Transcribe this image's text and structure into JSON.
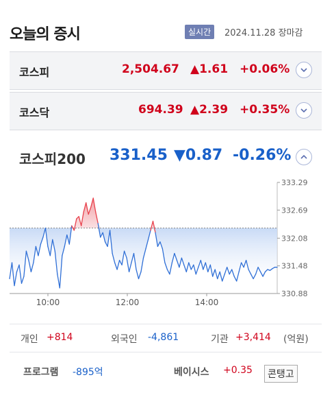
{
  "header": {
    "title": "오늘의 증시",
    "realtime_badge": "실시간",
    "date": "2024.11.28 장마감"
  },
  "indices": [
    {
      "name": "코스피",
      "value": "2,504.67",
      "change": "▲1.61",
      "pct": "+0.06%",
      "direction": "up"
    },
    {
      "name": "코스닥",
      "value": "694.39",
      "change": "▲2.39",
      "pct": "+0.35%",
      "direction": "up"
    }
  ],
  "kospi200": {
    "name": "코스피200",
    "value": "331.45",
    "change": "▼0.87",
    "pct": "-0.26%",
    "direction": "down"
  },
  "colors": {
    "up": "#d0021b",
    "down": "#1960c9",
    "badge": "#6f7fb3"
  },
  "icons": {
    "expand": "chevron-down-icon",
    "collapse": "chevron-up-icon"
  },
  "chart_data": {
    "type": "area",
    "x_ticks": [
      "10:00",
      "12:00",
      "14:00"
    ],
    "y_ticks": [
      "333.29",
      "332.69",
      "332.08",
      "331.48",
      "330.88"
    ],
    "ylim": [
      330.88,
      333.29
    ],
    "baseline": 332.3,
    "series": [
      {
        "values": [
          331.2,
          331.55,
          331.05,
          331.35,
          331.5,
          331.1,
          331.25,
          331.8,
          331.6,
          331.35,
          331.55,
          331.9,
          331.7,
          331.95,
          332.1,
          332.3,
          331.9,
          331.7,
          332.05,
          331.8,
          331.3,
          331.0,
          331.7,
          331.9,
          332.15,
          331.95,
          332.35,
          332.25,
          332.5,
          332.55,
          332.35,
          332.65,
          332.85,
          332.6,
          332.75,
          332.95,
          332.65,
          332.4,
          332.1,
          332.2,
          332.0,
          331.9,
          332.25,
          331.75,
          331.55,
          331.4,
          331.6,
          331.5,
          331.8,
          331.65,
          331.35,
          331.55,
          331.75,
          331.4,
          331.2,
          331.35,
          331.65,
          331.85,
          332.05,
          332.25,
          332.45,
          332.2,
          331.9,
          332.0,
          331.85,
          331.55,
          331.4,
          331.3,
          331.55,
          331.75,
          331.6,
          331.45,
          331.65,
          331.5,
          331.35,
          331.55,
          331.4,
          331.5,
          331.3,
          331.45,
          331.6,
          331.4,
          331.55,
          331.35,
          331.5,
          331.25,
          331.4,
          331.2,
          331.35,
          331.15,
          331.3,
          331.45,
          331.3,
          331.4,
          331.25,
          331.15,
          331.35,
          331.55,
          331.45,
          331.6,
          331.4,
          331.3,
          331.2,
          331.3,
          331.45,
          331.35,
          331.25,
          331.35,
          331.4,
          331.38,
          331.42,
          331.45,
          331.45
        ]
      }
    ]
  },
  "investors": {
    "individual_label": "개인",
    "individual_value": "+814",
    "foreign_label": "외국인",
    "foreign_value": "-4,861",
    "institution_label": "기관",
    "institution_value": "+3,414",
    "unit": "(억원)"
  },
  "program": {
    "label": "프로그램",
    "value": "-895억",
    "basis_label": "베이시스",
    "basis_value": "+0.35",
    "contango_label": "콘탱고"
  }
}
